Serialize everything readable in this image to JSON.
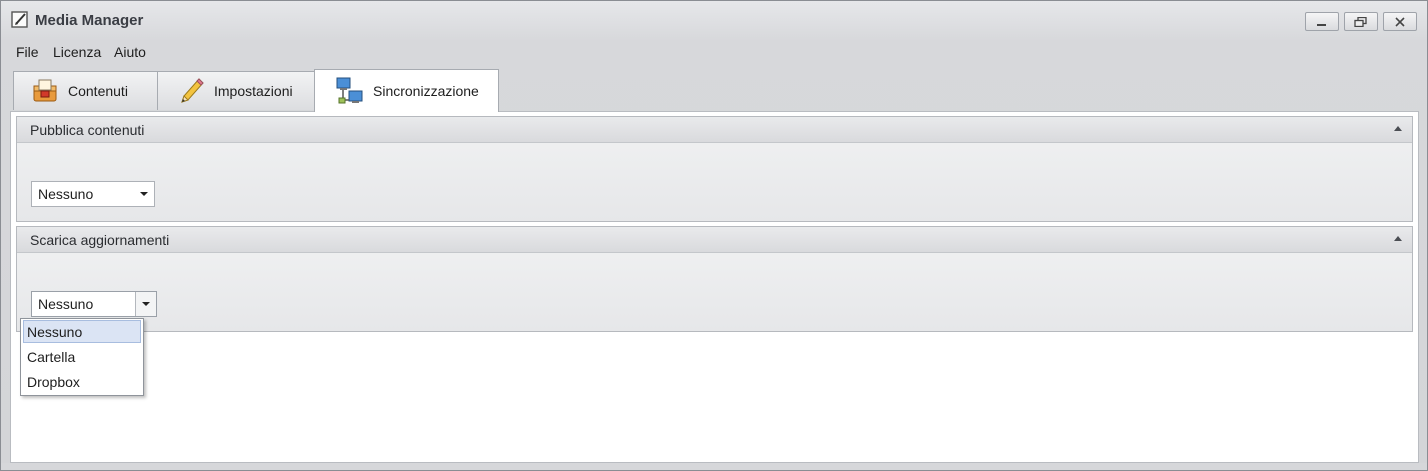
{
  "window": {
    "title": "Media Manager",
    "icon": "edit-document-icon",
    "controls": [
      "minimize-icon",
      "restore-icon",
      "close-icon"
    ]
  },
  "menu": {
    "items": [
      {
        "label": "File"
      },
      {
        "label": "Licenza"
      },
      {
        "label": "Aiuto"
      }
    ]
  },
  "tabs": [
    {
      "label": "Contenuti",
      "icon": "content-box-icon",
      "active": false
    },
    {
      "label": "Impostazioni",
      "icon": "pencil-icon",
      "active": false
    },
    {
      "label": "Sincronizzazione",
      "icon": "network-computers-icon",
      "active": true
    }
  ],
  "groups": {
    "publish": {
      "title": "Pubblica contenuti",
      "combo_value": "Nessuno"
    },
    "download": {
      "title": "Scarica aggiornamenti",
      "combo_value": "Nessuno",
      "dropdown_open": true,
      "options": [
        "Nessuno",
        "Cartella",
        "Dropbox"
      ],
      "selected_option": "Nessuno"
    }
  },
  "colors": {
    "selection_fill": "#dbe4f4",
    "selection_border": "#a8bddf"
  }
}
